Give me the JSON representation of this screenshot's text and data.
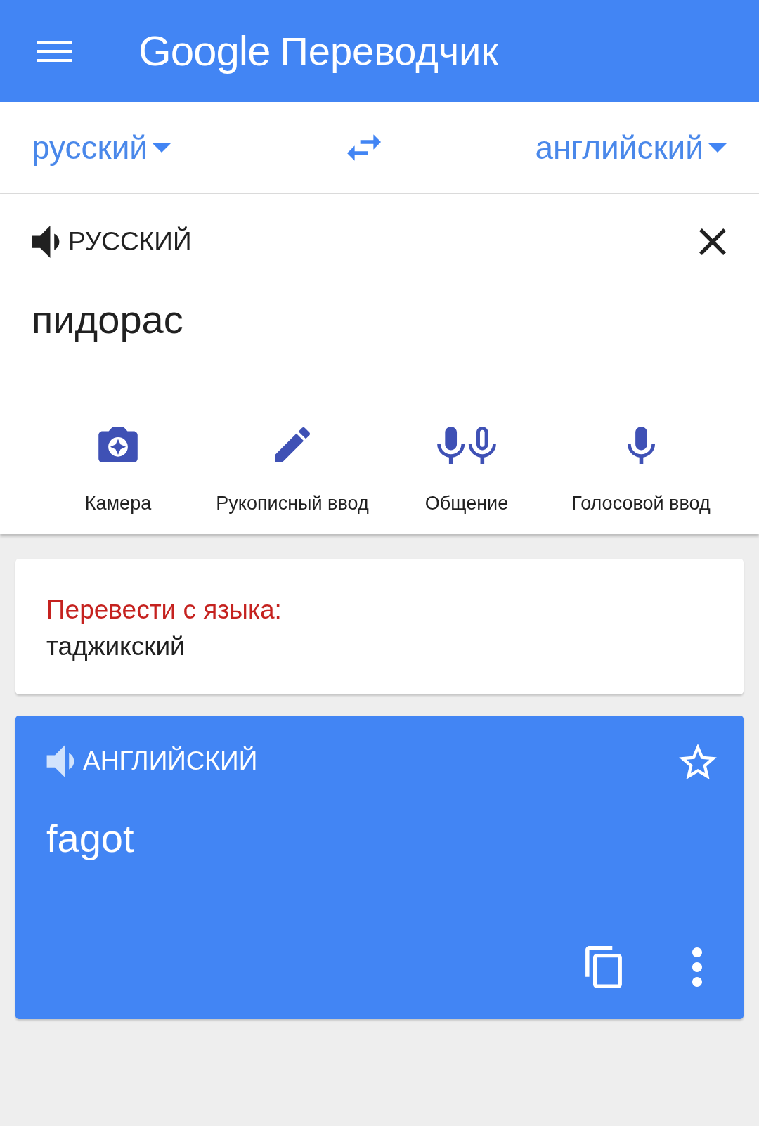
{
  "app_bar": {
    "logo": "Google",
    "title": "Переводчик"
  },
  "language_bar": {
    "source": "русский",
    "target": "английский"
  },
  "input": {
    "language_label": "РУССКИЙ",
    "text": "пидорас",
    "tools": [
      {
        "kind": "camera",
        "label": "Камера"
      },
      {
        "kind": "handwriting",
        "label": "Рукописный ввод"
      },
      {
        "kind": "conversation",
        "label": "Общение"
      },
      {
        "kind": "voice",
        "label": "Голосовой ввод"
      }
    ]
  },
  "suggestion_card": {
    "prompt": "Перевести с языка:",
    "language": "таджикский"
  },
  "result_card": {
    "language_label": "АНГЛИЙСКИЙ",
    "text": "fagot",
    "starred": false
  }
}
